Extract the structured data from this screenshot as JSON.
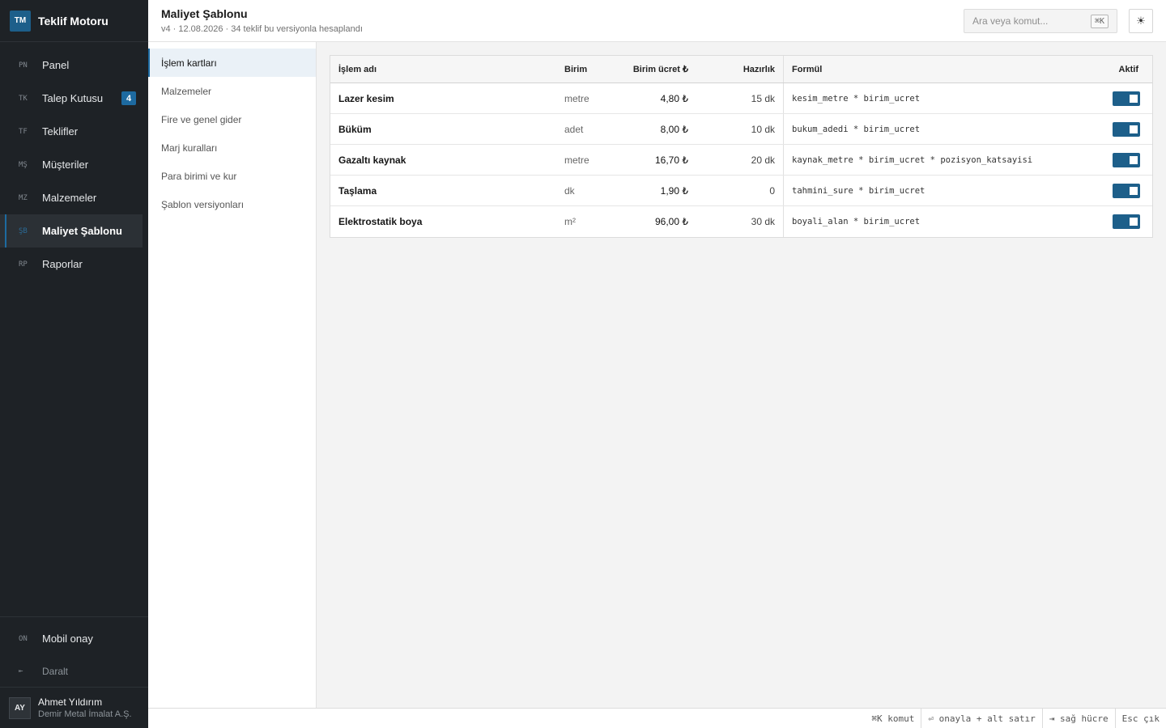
{
  "app": {
    "logo": "TM",
    "name": "Teklif Motoru"
  },
  "sidebar": {
    "items": [
      {
        "code": "PN",
        "label": "Panel"
      },
      {
        "code": "TK",
        "label": "Talep Kutusu",
        "badge": "4"
      },
      {
        "code": "TF",
        "label": "Teklifler"
      },
      {
        "code": "MŞ",
        "label": "Müşteriler"
      },
      {
        "code": "MZ",
        "label": "Malzemeler"
      },
      {
        "code": "ŞB",
        "label": "Maliyet Şablonu",
        "active": true
      },
      {
        "code": "RP",
        "label": "Raporlar"
      }
    ],
    "bottom": {
      "mobile": {
        "code": "ON",
        "label": "Mobil onay"
      },
      "collapse": {
        "icon": "⇤",
        "label": "Daralt"
      }
    },
    "user": {
      "initials": "AY",
      "name": "Ahmet Yıldırım",
      "company": "Demir Metal İmalat A.Ş."
    }
  },
  "header": {
    "title": "Maliyet Şablonu",
    "meta": "v4 · 12.08.2026 · 34 teklif bu versiyonla hesaplandı",
    "search_placeholder": "Ara veya komut...",
    "search_kbd": "⌘K",
    "theme_icon": "☀"
  },
  "subnav": {
    "items": [
      {
        "label": "İşlem kartları",
        "active": true
      },
      {
        "label": "Malzemeler"
      },
      {
        "label": "Fire ve genel gider"
      },
      {
        "label": "Marj kuralları"
      },
      {
        "label": "Para birimi ve kur"
      },
      {
        "label": "Şablon versiyonları"
      }
    ]
  },
  "table": {
    "columns": {
      "name": "İşlem adı",
      "unit": "Birim",
      "price": "Birim ücret ₺",
      "prep": "Hazırlık",
      "formula": "Formül",
      "active": "Aktif"
    },
    "rows": [
      {
        "name": "Lazer kesim",
        "unit": "metre",
        "price": "4,80 ₺",
        "prep": "15 dk",
        "formula": "kesim_metre * birim_ucret",
        "active": true
      },
      {
        "name": "Büküm",
        "unit": "adet",
        "price": "8,00 ₺",
        "prep": "10 dk",
        "formula": "bukum_adedi * birim_ucret",
        "active": true
      },
      {
        "name": "Gazaltı kaynak",
        "unit": "metre",
        "price": "16,70 ₺",
        "prep": "20 dk",
        "formula": "kaynak_metre * birim_ucret * pozisyon_katsayisi",
        "active": true
      },
      {
        "name": "Taşlama",
        "unit": "dk",
        "price": "1,90 ₺",
        "prep": "0",
        "formula": "tahmini_sure * birim_ucret",
        "active": true
      },
      {
        "name": "Elektrostatik boya",
        "unit": "m²",
        "price": "96,00 ₺",
        "prep": "30 dk",
        "formula": "boyali_alan * birim_ucret",
        "active": true
      }
    ]
  },
  "statusbar": {
    "items": [
      "⌘K komut",
      "⏎ onayla + alt satır",
      "⇥ sağ hücre",
      "Esc çık"
    ]
  }
}
